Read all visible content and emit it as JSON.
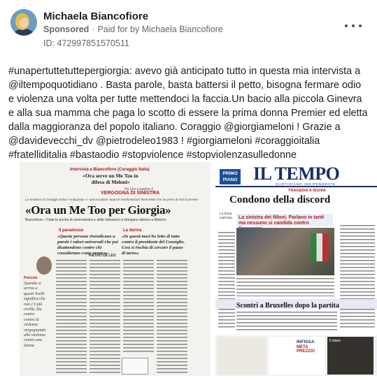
{
  "post": {
    "author": "Michaela Biancofiore",
    "sponsored": "Sponsored",
    "separator": "·",
    "paid_for": "Paid for by Michaela Biancofiore",
    "id_line": "ID: 472997851570511",
    "more_icon": "more-dots-icon",
    "text": "#unapertuttetuttepergiorgia: avevo già anticipato tutto in questa mia intervista a @iltempoquotidiano . Basta parole, basta battersi il petto, bisogna fermare odio e violenza una volta per tutte mettendoci la faccia.Un bacio alla piccola Ginevra e alla sua mamma che paga lo scotto di essere la prima donna Premier ed eletta dalla maggioranza del popolo italiano. Coraggio @giorgiameloni ! Grazie a @davidevecchi_dv @pietrodeleo1983 ! #giorgiameloni #coraggioitalia #fratelliditalia #bastaodio #stopviolence #stopviolenzasulledonne"
  },
  "left_paper": {
    "kicker": "Intervista a Biancofiore (Coraggio Italia)",
    "top_quote": "«Ora serve un Me Too in difesa di Meloni»",
    "byline_top": "De Leo a pagina 4",
    "ribbon": "VERGOGNA DI SINISTRA",
    "subkicker": "La senatrice di Coraggio Italia è «indignata» e «preoccupata» dopo le manifestazioni femministe che ha preso di mira il premier",
    "headline": "«Ora un Me Too per Giorgia»",
    "deck": "Biancofiore: «Tutte le donne di centrodestra e delle istituzioni si stringano attorno a Meloni»",
    "col1_h": "Il paradosso",
    "col1_q": "«Queste persone rivendicano a parole i valori universali che poi disattendono contro chi considerano come nemico»",
    "col2_h": "La deriva",
    "col2_q": "«In questi mesi ho letto di tutto contro il presidente del Consiglio. Così si rischia di cercare il pazzo di turno»",
    "author": "PIETRO DE LEO",
    "side_caption": "Pericolo",
    "side_text": "Quando si arriva a questi livelli significa che non c'è più civiltà. Da centro contro la violenza vergognando alla violenza contro una donna"
  },
  "right_paper": {
    "primo": "PRIMO PIANO",
    "masthead": "IL TEMPO",
    "mast_sub": "QUOTIDIANO INDIPENDENTE",
    "tragedy": "TRAGEDIA A ISCHIA",
    "headline": "Condono della discord",
    "band": "La sinistra dei filloni. Parlano in tanti ma nessuno si candida contro Bonaccini",
    "side_note": "La frana sull'isola",
    "headline2": "Scontri a Bruxelles dopo la partita",
    "ad_b_1": "INFISSA",
    "ad_b_2": "META PREZZO!",
    "ad_c": "Il diario"
  }
}
